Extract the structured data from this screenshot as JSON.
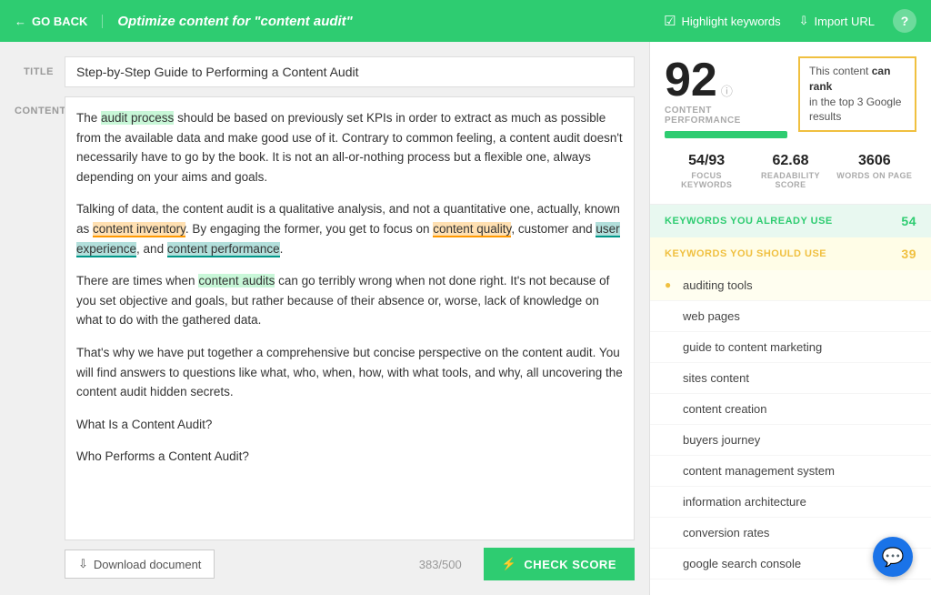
{
  "header": {
    "back_label": "GO BACK",
    "title_prefix": "Optimize content for",
    "title_keyword": "\"content audit\"",
    "highlight_label": "Highlight keywords",
    "import_label": "Import URL",
    "help_label": "?"
  },
  "editor": {
    "title_label": "TITLE",
    "content_label": "CONTENT",
    "title_value": "Step-by-Step Guide to Performing a Content Audit",
    "char_count": "383/500",
    "paragraphs": [
      "The audit process should be based on previously set KPIs in order to extract as much as possible from the available data and make good use of it. Contrary to common feeling, a content audit doesn't necessarily have to go by the book. It is not an all-or-nothing process but a flexible one, always depending on your aims and goals.",
      "Talking of data, the content audit is a qualitative analysis, and not a quantitative one, actually, known as content inventory. By engaging the former, you get to focus on content quality, customer and user experience, and content performance.",
      "There are times when content audits can go terribly wrong when not done right. It's not because of you set objective and goals, but rather because of their absence or, worse, lack of knowledge on what to do with the gathered data.",
      "That's why we have put together a comprehensive but concise perspective on the content audit. You will find answers to questions like what, who, when, how, with what tools, and why, all uncovering the content audit hidden secrets.",
      "What Is a Content Audit?",
      "Who Performs a Content Audit?"
    ],
    "download_label": "Download document",
    "check_score_label": "CHECK SCORE"
  },
  "score": {
    "value": "92",
    "performance_label": "CONTENT PERFORMANCE",
    "rank_text_1": "This content",
    "rank_text_2": "can rank",
    "rank_text_3": "in the top 3 Google results",
    "metrics": [
      {
        "value": "54/93",
        "label": "FOCUS KEYWORDS"
      },
      {
        "value": "62.68",
        "label": "READABILITY SCORE"
      },
      {
        "value": "3606",
        "label": "WORDS ON PAGE"
      }
    ]
  },
  "keywords": {
    "already_use_label": "KEYWORDS YOU ALREADY USE",
    "already_use_count": "54",
    "should_use_label": "KEYWORDS YOU SHOULD USE",
    "should_use_count": "39",
    "should_use_items": [
      {
        "text": "auditing tools",
        "active": true
      },
      {
        "text": "web pages",
        "active": false
      },
      {
        "text": "guide to content marketing",
        "active": false
      },
      {
        "text": "sites content",
        "active": false
      },
      {
        "text": "content creation",
        "active": false
      },
      {
        "text": "buyers journey",
        "active": false
      },
      {
        "text": "content management system",
        "active": false
      },
      {
        "text": "information architecture",
        "active": false
      },
      {
        "text": "conversion rates",
        "active": false
      },
      {
        "text": "google search console",
        "active": false
      }
    ]
  },
  "colors": {
    "green": "#2ecc71",
    "yellow": "#f0c040",
    "blue": "#1a73e8"
  }
}
